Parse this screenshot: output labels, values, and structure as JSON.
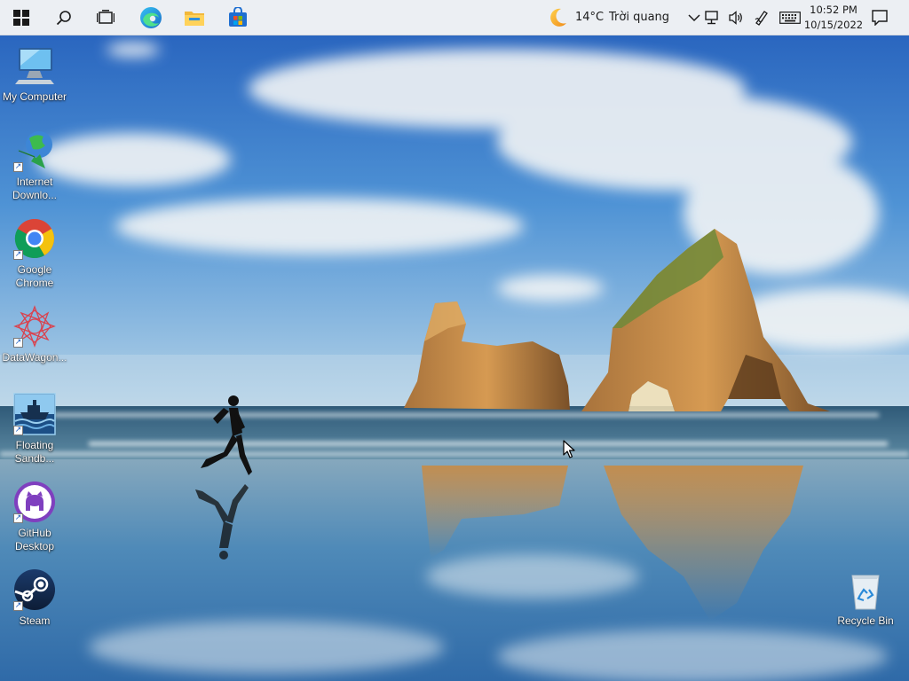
{
  "taskbar": {
    "weather_temp": "14°C",
    "weather_desc": "Trời quang",
    "time": "10:52 PM",
    "date": "10/15/2022",
    "pinned": [
      "start-icon",
      "search-icon",
      "task-view-icon",
      "edge-icon",
      "file-explorer-icon",
      "store-icon"
    ],
    "tray": [
      "chevron-up-icon",
      "network-icon",
      "volume-icon",
      "pen-icon",
      "keyboard-icon",
      "notification-icon"
    ]
  },
  "desktop": {
    "icons": [
      {
        "label": "My Computer",
        "icon": "computer-icon"
      },
      {
        "label": "Internet Downlo...",
        "icon": "idm-icon"
      },
      {
        "label": "Google Chrome",
        "icon": "chrome-icon"
      },
      {
        "label": "DataWagon...",
        "icon": "datawagon-icon"
      },
      {
        "label": "Floating Sandb...",
        "icon": "floating-sandbox-icon"
      },
      {
        "label": "GitHub Desktop",
        "icon": "github-icon"
      },
      {
        "label": "Steam",
        "icon": "steam-icon"
      },
      {
        "label": "Recycle Bin",
        "icon": "recycle-bin-icon"
      }
    ]
  },
  "colors": {
    "taskbar_bg": "#eceff3",
    "sky_top": "#2c6fc4",
    "sky_bottom": "#b9d6ea",
    "sea": "#3f6f8a",
    "rock": "#c08a4a"
  }
}
